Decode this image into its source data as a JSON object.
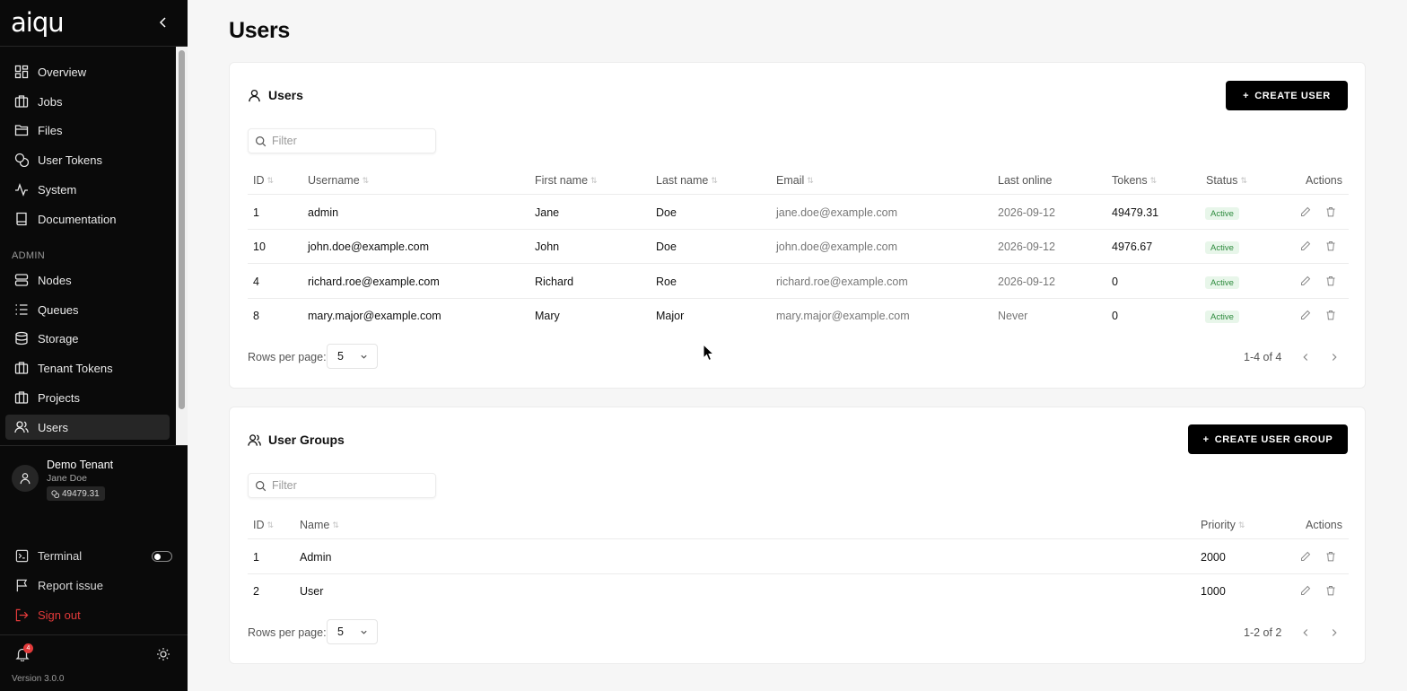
{
  "sidebar": {
    "logo": "aiqu",
    "nav": [
      {
        "label": "Overview",
        "icon": "grid-icon"
      },
      {
        "label": "Jobs",
        "icon": "briefcase-icon"
      },
      {
        "label": "Files",
        "icon": "folder-icon"
      },
      {
        "label": "User Tokens",
        "icon": "coins-icon"
      },
      {
        "label": "System",
        "icon": "activity-icon"
      },
      {
        "label": "Documentation",
        "icon": "book-icon"
      }
    ],
    "admin_label": "ADMIN",
    "admin_nav": [
      {
        "label": "Nodes",
        "icon": "server-icon"
      },
      {
        "label": "Queues",
        "icon": "list-icon"
      },
      {
        "label": "Storage",
        "icon": "database-icon"
      },
      {
        "label": "Tenant Tokens",
        "icon": "coins-icon"
      },
      {
        "label": "Projects",
        "icon": "briefcase-icon"
      },
      {
        "label": "Users",
        "icon": "users-icon",
        "active": true
      }
    ],
    "tenant": {
      "name": "Demo Tenant",
      "user": "Jane Doe",
      "tokens": "49479.31"
    },
    "terminal_label": "Terminal",
    "terminal_enabled": false,
    "report_label": "Report issue",
    "signout_label": "Sign out",
    "notification_count": "4",
    "version": "Version 3.0.0",
    "signout_color": "#e23a3a"
  },
  "page": {
    "title": "Users"
  },
  "users_card": {
    "title": "Users",
    "create_button": "CREATE USER",
    "filter_placeholder": "Filter",
    "columns": {
      "id": "ID",
      "username": "Username",
      "first_name": "First name",
      "last_name": "Last name",
      "email": "Email",
      "last_online": "Last online",
      "tokens": "Tokens",
      "status": "Status",
      "actions": "Actions"
    },
    "rows": [
      {
        "id": "1",
        "username": "admin",
        "first_name": "Jane",
        "last_name": "Doe",
        "email": "jane.doe@example.com",
        "last_online": "2026-09-12",
        "tokens": "49479.31",
        "status": "Active"
      },
      {
        "id": "10",
        "username": "john.doe@example.com",
        "first_name": "John",
        "last_name": "Doe",
        "email": "john.doe@example.com",
        "last_online": "2026-09-12",
        "tokens": "4976.67",
        "status": "Active"
      },
      {
        "id": "4",
        "username": "richard.roe@example.com",
        "first_name": "Richard",
        "last_name": "Roe",
        "email": "richard.roe@example.com",
        "last_online": "2026-09-12",
        "tokens": "0",
        "status": "Active"
      },
      {
        "id": "8",
        "username": "mary.major@example.com",
        "first_name": "Mary",
        "last_name": "Major",
        "email": "mary.major@example.com",
        "last_online": "Never",
        "tokens": "0",
        "status": "Active"
      }
    ],
    "rows_per_page_label": "Rows per page:",
    "rows_per_page": "5",
    "pagination": "1-4 of 4"
  },
  "groups_card": {
    "title": "User Groups",
    "create_button": "CREATE USER GROUP",
    "filter_placeholder": "Filter",
    "columns": {
      "id": "ID",
      "name": "Name",
      "priority": "Priority",
      "actions": "Actions"
    },
    "rows": [
      {
        "id": "1",
        "name": "Admin",
        "priority": "2000"
      },
      {
        "id": "2",
        "name": "User",
        "priority": "1000"
      }
    ],
    "rows_per_page_label": "Rows per page:",
    "rows_per_page": "5",
    "pagination": "1-2 of 2"
  }
}
